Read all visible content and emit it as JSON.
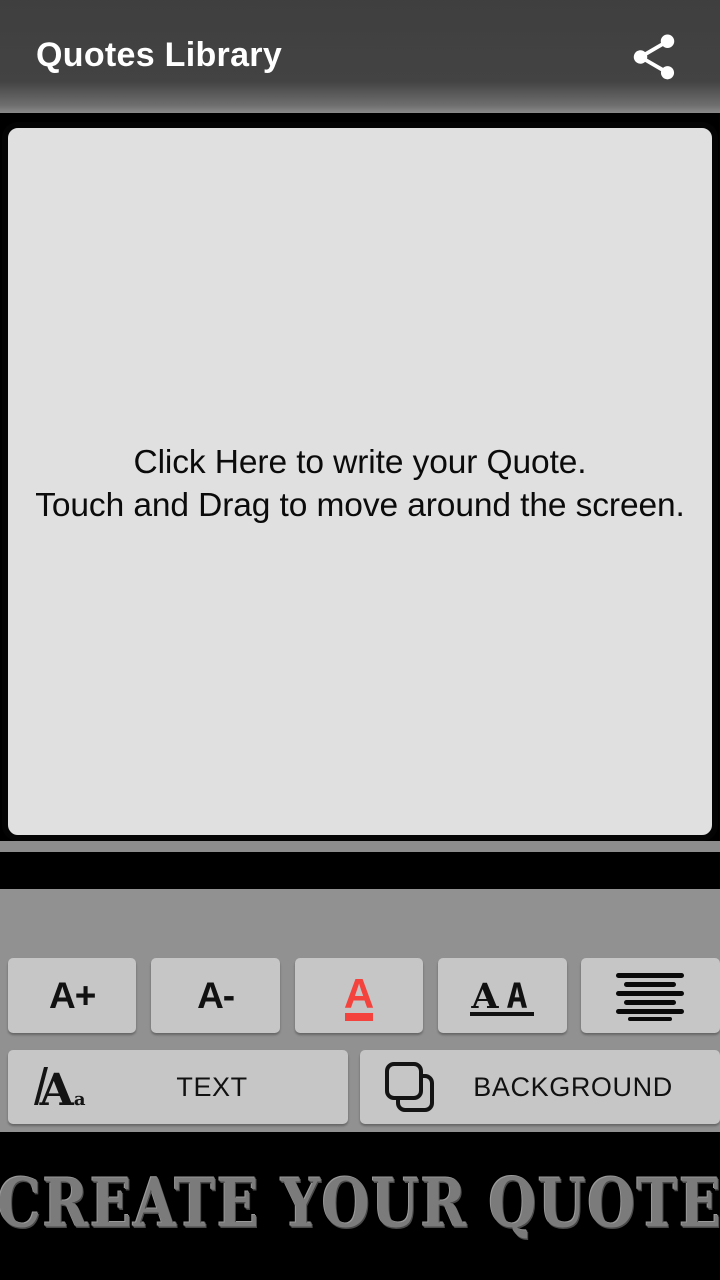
{
  "appbar": {
    "title": "Quotes Library",
    "share_icon": "share-icon",
    "background_color": "#424242",
    "title_color": "#ffffff"
  },
  "canvas": {
    "hint_text": "Click Here to write your Quote.\nTouch and Drag to move around the screen.",
    "background_color": "#e0e0e0",
    "border_color": "#040404"
  },
  "toolbar": {
    "background_color": "#919191",
    "button_color": "#c6c6c6",
    "row_top": [
      {
        "label": "A+",
        "name": "increase-font-size-button",
        "icon": ""
      },
      {
        "label": "A-",
        "name": "decrease-font-size-button",
        "icon": ""
      },
      {
        "label": "",
        "name": "text-color-button",
        "icon": "red-letter-a-underline-icon",
        "accent_color": "#f4433c"
      },
      {
        "label": "",
        "name": "font-family-button",
        "icon": "two-letter-a-underline-icon"
      },
      {
        "label": "",
        "name": "text-alignment-button",
        "icon": "align-center-lines-icon"
      }
    ],
    "row_bottom": [
      {
        "label": "TEXT",
        "name": "text-button",
        "icon": "stylized-aa-icon"
      },
      {
        "label": "BACKGROUND",
        "name": "background-button",
        "icon": "overlapping-squares-icon"
      }
    ]
  },
  "footer": {
    "banner_text": "Create Your Quote",
    "text_color": "#7b7b7b",
    "background_color": "#000000"
  }
}
